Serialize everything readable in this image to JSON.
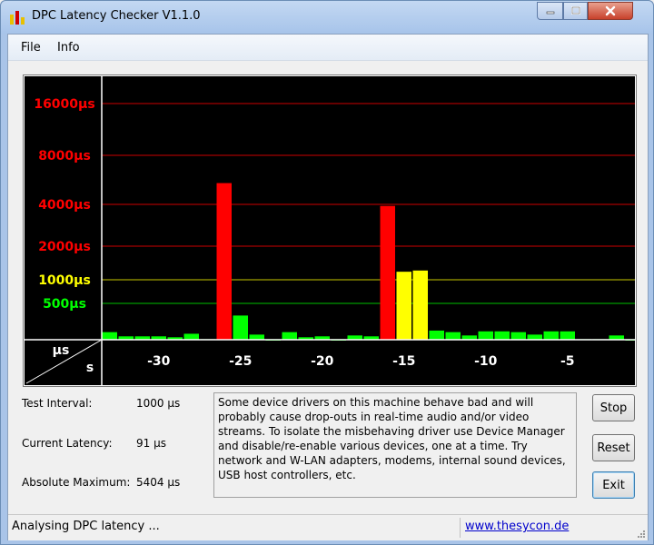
{
  "window": {
    "title": "DPC Latency Checker V1.1.0"
  },
  "menu": {
    "file": "File",
    "info": "Info"
  },
  "chart_data": {
    "type": "bar",
    "y_scale": "log",
    "y_tick_labels": [
      "16000µs",
      "8000µs",
      "4000µs",
      "2000µs",
      "1000µs",
      "500µs"
    ],
    "y_ticks": [
      16000,
      8000,
      4000,
      2000,
      1000,
      500
    ],
    "y_unit_label": "µs",
    "x_unit_label": "s",
    "x_tick_labels": [
      "-30",
      "-25",
      "-20",
      "-15",
      "-10",
      "-5"
    ],
    "x_ticks": [
      -30,
      -25,
      -20,
      -15,
      -10,
      -5
    ],
    "xlim": [
      -33,
      0
    ],
    "ylim": [
      100,
      25000
    ],
    "threshold_colors": {
      "green": "#00ff00",
      "yellow": "#ffff00",
      "red": "#ff0000"
    },
    "grid_colors": {
      "red": "#cc0000",
      "yellow": "#c8c800",
      "green": "#00c000"
    },
    "bars": [
      {
        "x": -33,
        "value": 215
      },
      {
        "x": -32,
        "value": 190
      },
      {
        "x": -31,
        "value": 190
      },
      {
        "x": -30,
        "value": 190
      },
      {
        "x": -29,
        "value": 185
      },
      {
        "x": -28,
        "value": 205
      },
      {
        "x": -27,
        "value": 175
      },
      {
        "x": -26,
        "value": 5404
      },
      {
        "x": -25,
        "value": 350
      },
      {
        "x": -24,
        "value": 200
      },
      {
        "x": -23,
        "value": 165
      },
      {
        "x": -22,
        "value": 215
      },
      {
        "x": -21,
        "value": 185
      },
      {
        "x": -20,
        "value": 190
      },
      {
        "x": -19,
        "value": 170
      },
      {
        "x": -18,
        "value": 195
      },
      {
        "x": -17,
        "value": 190
      },
      {
        "x": -16,
        "value": 3900
      },
      {
        "x": -15,
        "value": 1180
      },
      {
        "x": -14,
        "value": 1210
      },
      {
        "x": -13,
        "value": 225
      },
      {
        "x": -12,
        "value": 215
      },
      {
        "x": -11,
        "value": 195
      },
      {
        "x": -10,
        "value": 220
      },
      {
        "x": -9,
        "value": 220
      },
      {
        "x": -8,
        "value": 215
      },
      {
        "x": -7,
        "value": 200
      },
      {
        "x": -6,
        "value": 220
      },
      {
        "x": -5,
        "value": 220
      },
      {
        "x": -4,
        "value": 175
      },
      {
        "x": -3,
        "value": 175
      },
      {
        "x": -2,
        "value": 195
      },
      {
        "x": -1,
        "value": 170
      }
    ]
  },
  "info": {
    "test_interval_label": "Test Interval:",
    "test_interval_value": "1000 µs",
    "current_latency_label": "Current Latency:",
    "current_latency_value": "91 µs",
    "absolute_maximum_label": "Absolute Maximum:",
    "absolute_maximum_value": "5404 µs"
  },
  "message": {
    "text": "Some device drivers on this machine behave bad and will probably cause drop-outs in real-time audio and/or video streams. To isolate the misbehaving driver use Device Manager and disable/re-enable various devices, one at a time. Try network and W-LAN adapters, modems, internal sound devices, USB host controllers, etc."
  },
  "buttons": {
    "stop": "Stop",
    "reset": "Reset",
    "exit": "Exit"
  },
  "status": {
    "text": "Analysing DPC latency ...",
    "link": "www.thesycon.de"
  },
  "icons": {
    "app": "bar-chart-icon",
    "minimize": "minimize-icon",
    "maximize": "maximize-icon",
    "close": "close-icon",
    "grip": "resize-grip-icon"
  }
}
